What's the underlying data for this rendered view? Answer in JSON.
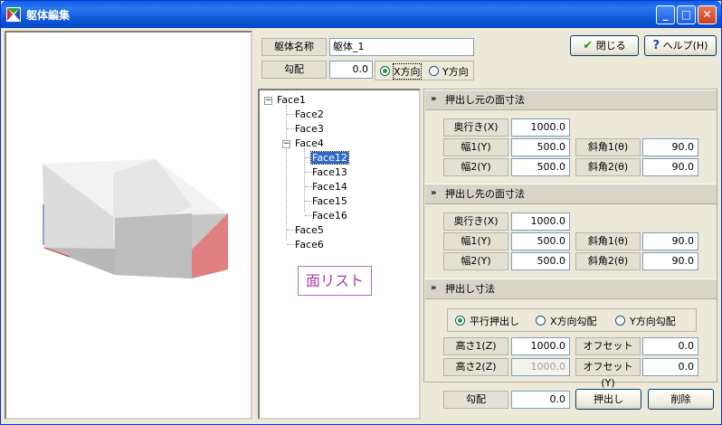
{
  "window": {
    "title": "躯体編集",
    "minimize": "_",
    "maximize": "□",
    "close": "✕"
  },
  "header": {
    "name_label": "躯体名称",
    "name_value": "躯体_1",
    "slope_label": "勾配",
    "slope_value": "0.0",
    "dir_x": "X方向",
    "dir_y": "Y方向",
    "close_btn": "閉じる",
    "help_btn": "ヘルプ(H)"
  },
  "tree": {
    "items": [
      "Face1",
      "Face2",
      "Face3",
      "Face4",
      "Face12",
      "Face13",
      "Face14",
      "Face15",
      "Face16",
      "Face5",
      "Face6"
    ],
    "selected": "Face12",
    "annotation": "面リスト"
  },
  "sections": {
    "source": {
      "title": "押出し元の面寸法",
      "depth_label": "奥行き(X)",
      "depth": "1000.0",
      "w1_label": "幅1(Y)",
      "w1": "500.0",
      "w2_label": "幅2(Y)",
      "w2": "500.0",
      "a1_label": "斜角1(θ)",
      "a1": "90.0",
      "a2_label": "斜角2(θ)",
      "a2": "90.0"
    },
    "target": {
      "title": "押出し先の面寸法",
      "depth_label": "奥行き(X)",
      "depth": "1000.0",
      "w1_label": "幅1(Y)",
      "w1": "500.0",
      "w2_label": "幅2(Y)",
      "w2": "500.0",
      "a1_label": "斜角1(θ)",
      "a1": "90.0",
      "a2_label": "斜角2(θ)",
      "a2": "90.0"
    },
    "extrude": {
      "title": "押出し寸法",
      "opt1": "平行押出し",
      "opt2": "X方向勾配",
      "opt3": "Y方向勾配",
      "h1_label": "高さ1(Z)",
      "h1": "1000.0",
      "h2_label": "高さ2(Z)",
      "h2": "1000.0",
      "ox_label": "オフセット(X)",
      "ox": "0.0",
      "oy_label": "オフセット(Y)",
      "oy": "0.0"
    }
  },
  "footer": {
    "slope_label": "勾配",
    "slope_value": "0.0",
    "extrude_btn": "押出し",
    "delete_btn": "削除"
  },
  "colors": {
    "selection": "#316ac5",
    "face_red": "#e08080",
    "titlebar": "#0a5fe3"
  }
}
